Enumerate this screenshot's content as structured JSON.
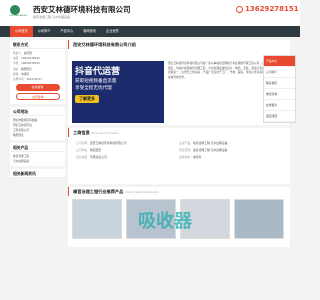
{
  "header": {
    "logo_text": "YONGJIAHUANJING",
    "company_name": "西安艾林德环境科技有限公司",
    "company_sub": "噪音治理工程,污水处理设备",
    "phone": "13629278151"
  },
  "nav": [
    "公司首页",
    "公司简介",
    "产品中心",
    "新闻资讯",
    "企业资质"
  ],
  "sidebar": {
    "contact_title": "联系方式",
    "contact_rows": [
      {
        "k": "联系人：",
        "v": "秦经理"
      },
      {
        "k": "电话：",
        "v": "13629278151"
      },
      {
        "k": "手机：",
        "v": "13629278151"
      },
      {
        "k": "地址：",
        "v": "陕西西安"
      },
      {
        "k": "邮箱：",
        "v": "未填写"
      },
      {
        "k": "注册时间：",
        "v": "2023-06-07"
      }
    ],
    "btn_message": "在线留言",
    "btn_call": "立即咨询",
    "address_title": "公司地址",
    "address_rows": [
      "西安市雁塔区科技路",
      "西安艾林德环境",
      "工程有限公司",
      "陕西西安"
    ],
    "cat_title": "相关产品",
    "cat_items": [
      "噪音治理工程",
      "污水处理设备"
    ],
    "news_title": "相关新闻资讯"
  },
  "main": {
    "intro_title": "西安艾林德环境科技有限公司介绍",
    "banner_title": "抖音代运营",
    "banner_lines": [
      "获取短视频垂直流量",
      "享受全程无忧代理"
    ],
    "banner_btn": "了解更多",
    "intro_text": "西安艾林德环境科技有限公司是一家从事噪音治理和污水处理的环保工程公司，公司拥有专业技术团队，为客户提供噪音治理工程、污水处理设备的设计、制造、安装、调试与售后服务。公司坚持质量第一、信誉至上的宗旨，产品广泛应用于工厂、学校、医院、住宅小区等领域，欢迎新老客户来电咨询合作。",
    "info_title": "工商信息",
    "info_title_en": "Business Information",
    "info_cells": [
      {
        "k": "公司名称：",
        "v": "西安艾林德环境科技有限公司"
      },
      {
        "k": "主营产品：",
        "v": "噪音治理工程,污水处理设备"
      },
      {
        "k": "公司地址：",
        "v": "陕西西安"
      },
      {
        "k": "经营范围：",
        "v": "噪音治理工程,污水处理设备"
      },
      {
        "k": "企业类型：",
        "v": "有限责任公司"
      },
      {
        "k": "注册资本：",
        "v": "未填写"
      }
    ],
    "products_title": "噪音治理工程行业推荐产品",
    "products_title_en": "Product Recommendation",
    "watermark": "吸收器"
  },
  "float_panel": [
    "产品中心",
    "公司简介",
    "联系我们",
    "电话咨询",
    "在线留言",
    "返回顶部"
  ],
  "colors": {
    "accent": "#e8492f",
    "nav": "#2f3a40",
    "brand": "#2e8b57"
  }
}
